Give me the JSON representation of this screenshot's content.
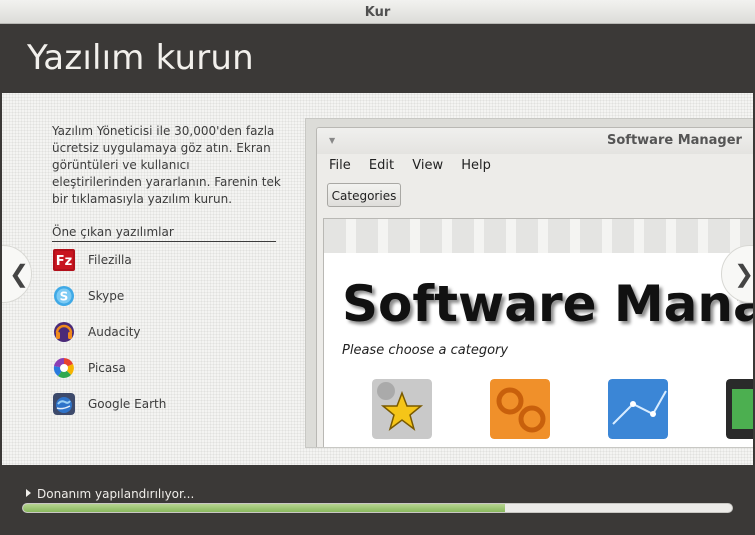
{
  "window": {
    "title": "Kur"
  },
  "header": {
    "title": "Yazılım kurun"
  },
  "description": "Yazılım Yöneticisi ile 30,000'den fazla ücretsiz uygulamaya göz atın. Ekran görüntüleri ve kullanıcı eleştirilerinden yararlanın. Farenin tek bir tıklamasıyla yazılım kurun.",
  "featured": {
    "title": "Öne çıkan yazılımlar",
    "items": [
      {
        "label": "Filezilla",
        "icon": "filezilla-icon"
      },
      {
        "label": "Skype",
        "icon": "skype-icon"
      },
      {
        "label": "Audacity",
        "icon": "audacity-icon"
      },
      {
        "label": "Picasa",
        "icon": "picasa-icon"
      },
      {
        "label": "Google Earth",
        "icon": "google-earth-icon"
      }
    ]
  },
  "nav": {
    "prev": "❮",
    "next": "❯"
  },
  "preview": {
    "window_title": "Software Manager",
    "menu": [
      "File",
      "Edit",
      "View",
      "Help"
    ],
    "button": "Categories",
    "banner": "Software Manager",
    "subtitle": "Please choose a category"
  },
  "status": {
    "text": "Donanım yapılandırılıyor...",
    "progress": 0.68
  }
}
